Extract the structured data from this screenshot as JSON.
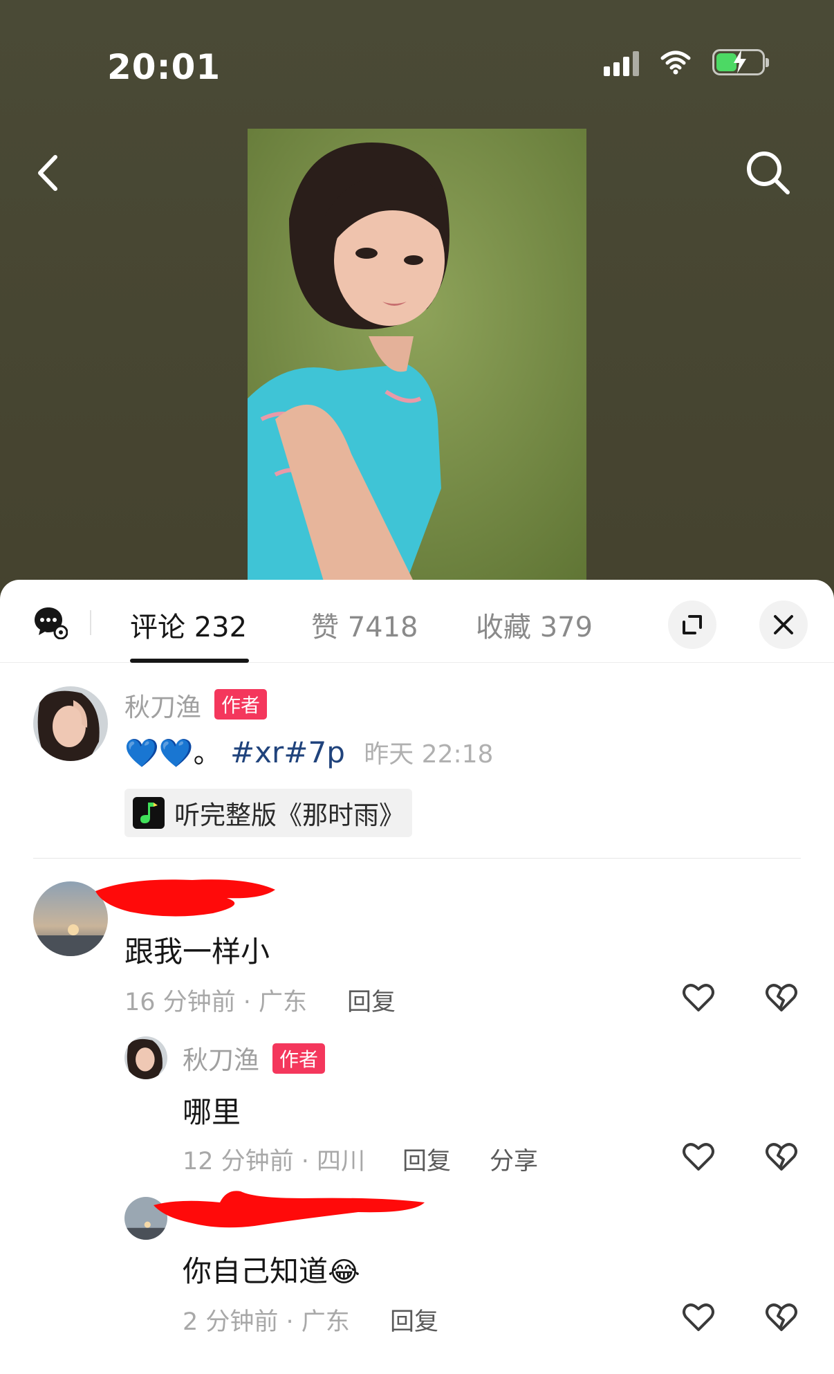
{
  "status_bar": {
    "time": "20:01",
    "battery_color": "#4cd964"
  },
  "nav": {
    "back_icon": "chevron-left-icon",
    "search_icon": "search-icon"
  },
  "tabs": [
    {
      "label": "评论 232",
      "active": true
    },
    {
      "label": "赞 7418",
      "active": false
    },
    {
      "label": "收藏 379",
      "active": false
    }
  ],
  "sheet_actions": {
    "expand_icon": "expand-icon",
    "close_icon": "close-icon"
  },
  "author_post": {
    "name": "秋刀渔",
    "badge": "作者",
    "emoji_text": "💙💙。",
    "hashtags": "#xr#7p",
    "time": "昨天 22:18",
    "music_label": "听完整版《那时雨》"
  },
  "comments": [
    {
      "name": "",
      "text": "跟我一样小",
      "meta": "16 分钟前 · 广东",
      "reply_label": "回复"
    },
    {
      "name": "秋刀渔",
      "badge": "作者",
      "text": "哪里",
      "meta": "12 分钟前 · 四川",
      "reply_label": "回复",
      "share_label": "分享"
    },
    {
      "name": "",
      "text": "你自己知道",
      "emoji": "😂",
      "meta": "2 分钟前 · 广东",
      "reply_label": "回复"
    }
  ],
  "colors": {
    "accent_badge": "#f4375c",
    "hashtag": "#20437c"
  }
}
